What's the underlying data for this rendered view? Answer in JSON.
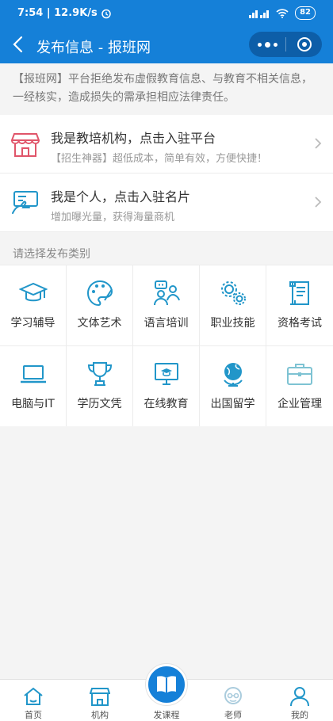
{
  "statusbar": {
    "time_speed": "7:54 | 12.9K/s",
    "battery": "82"
  },
  "navbar": {
    "title": "发布信息 - 报班网"
  },
  "notice": "【报班网】平台拒绝发布虚假教育信息、与教育不相关信息，一经核实，造成损失的需承担相应法律责任。",
  "cards": [
    {
      "title": "我是教培机构，点击入驻平台",
      "subtitle": "【招生神器】超低成本，简单有效，方便快捷！",
      "icon": "storefront-icon"
    },
    {
      "title": "我是个人，点击入驻名片",
      "subtitle": "增加曝光量，获得海量商机",
      "icon": "business-card-icon"
    }
  ],
  "section_title": "请选择发布类别",
  "categories": [
    {
      "label": "学习辅导",
      "icon": "graduation-cap-icon"
    },
    {
      "label": "文体艺术",
      "icon": "palette-icon"
    },
    {
      "label": "语言培训",
      "icon": "people-chat-icon"
    },
    {
      "label": "职业技能",
      "icon": "gears-icon"
    },
    {
      "label": "资格考试",
      "icon": "scroll-icon"
    },
    {
      "label": "电脑与IT",
      "icon": "laptop-icon"
    },
    {
      "label": "学历文凭",
      "icon": "trophy-icon"
    },
    {
      "label": "在线教育",
      "icon": "monitor-cap-icon"
    },
    {
      "label": "出国留学",
      "icon": "globe-icon"
    },
    {
      "label": "企业管理",
      "icon": "briefcase-icon"
    }
  ],
  "tabs": [
    {
      "label": "首页",
      "icon": "home-icon"
    },
    {
      "label": "机构",
      "icon": "shop-icon"
    },
    {
      "label": "发课程",
      "icon": "book-icon"
    },
    {
      "label": "老师",
      "icon": "teacher-icon"
    },
    {
      "label": "我的",
      "icon": "user-icon"
    }
  ],
  "colors": {
    "primary": "#1580d8",
    "icon": "#2196c9",
    "card_icon_1": "#e0556a",
    "background": "#f4f4f4"
  }
}
